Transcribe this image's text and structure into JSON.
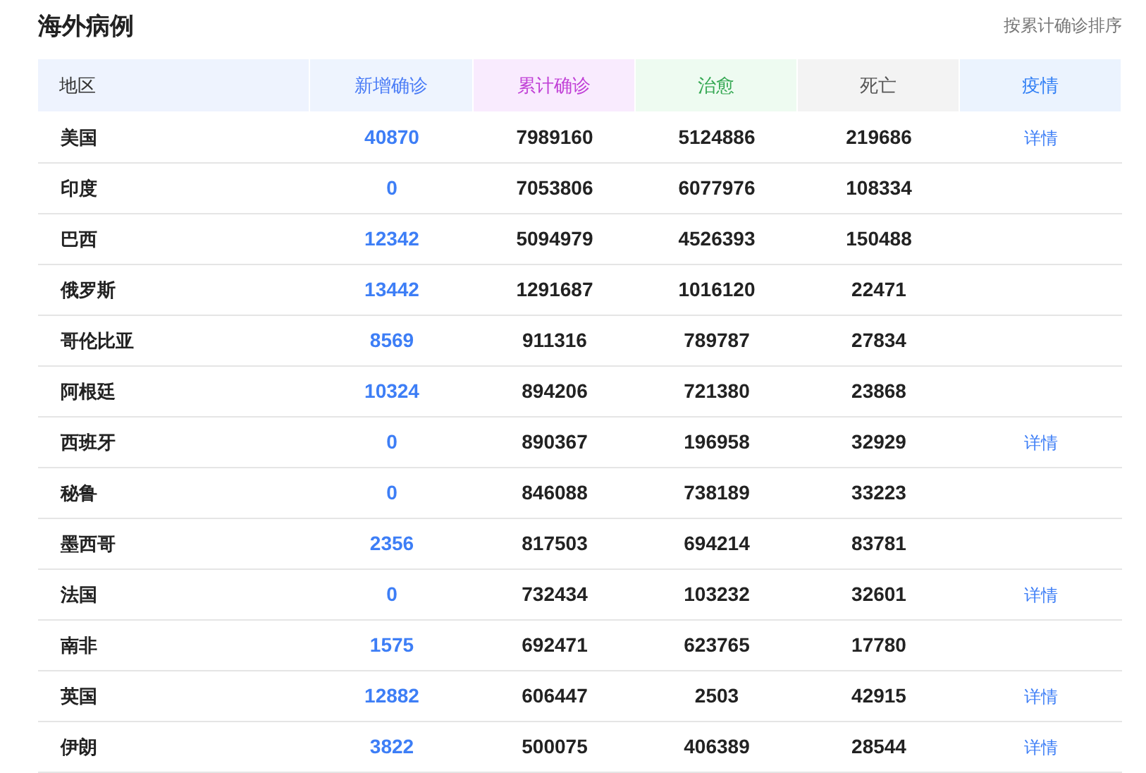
{
  "title": "海外病例",
  "sort_link": "按累计确诊排序",
  "columns": [
    {
      "label": "地区",
      "color": "#333333"
    },
    {
      "label": "新增确诊",
      "color": "#4a7cf6"
    },
    {
      "label": "累计确诊",
      "color": "#c03fd6"
    },
    {
      "label": "治愈",
      "color": "#35a853"
    },
    {
      "label": "死亡",
      "color": "#555555"
    },
    {
      "label": "疫情",
      "color": "#2f7ef5"
    }
  ],
  "rows": [
    {
      "region": "美国",
      "new": "40870",
      "total": "7989160",
      "cured": "5124886",
      "dead": "219686",
      "detail": "详情"
    },
    {
      "region": "印度",
      "new": "0",
      "total": "7053806",
      "cured": "6077976",
      "dead": "108334"
    },
    {
      "region": "巴西",
      "new": "12342",
      "total": "5094979",
      "cured": "4526393",
      "dead": "150488"
    },
    {
      "region": "俄罗斯",
      "new": "13442",
      "total": "1291687",
      "cured": "1016120",
      "dead": "22471"
    },
    {
      "region": "哥伦比亚",
      "new": "8569",
      "total": "911316",
      "cured": "789787",
      "dead": "27834"
    },
    {
      "region": "阿根廷",
      "new": "10324",
      "total": "894206",
      "cured": "721380",
      "dead": "23868"
    },
    {
      "region": "西班牙",
      "new": "0",
      "total": "890367",
      "cured": "196958",
      "dead": "32929",
      "detail": "详情"
    },
    {
      "region": "秘鲁",
      "new": "0",
      "total": "846088",
      "cured": "738189",
      "dead": "33223"
    },
    {
      "region": "墨西哥",
      "new": "2356",
      "total": "817503",
      "cured": "694214",
      "dead": "83781"
    },
    {
      "region": "法国",
      "new": "0",
      "total": "732434",
      "cured": "103232",
      "dead": "32601",
      "detail": "详情"
    },
    {
      "region": "南非",
      "new": "1575",
      "total": "692471",
      "cured": "623765",
      "dead": "17780"
    },
    {
      "region": "英国",
      "new": "12882",
      "total": "606447",
      "cured": "2503",
      "dead": "42915",
      "detail": "详情"
    },
    {
      "region": "伊朗",
      "new": "3822",
      "total": "500075",
      "cured": "406389",
      "dead": "28544",
      "detail": "详情"
    }
  ]
}
